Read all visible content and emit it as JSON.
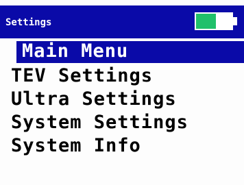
{
  "window": {
    "title": "Settings"
  },
  "status": {
    "battery_level": 0.55,
    "battery_color": "#20c06a"
  },
  "menu": {
    "items": [
      {
        "label": "Main Menu",
        "selected": true
      },
      {
        "label": "TEV Settings",
        "selected": false
      },
      {
        "label": "Ultra Settings",
        "selected": false
      },
      {
        "label": "System Settings",
        "selected": false
      },
      {
        "label": "System Info",
        "selected": false
      }
    ]
  },
  "colors": {
    "accent": "#0a0aa8",
    "background": "#fdfdfd",
    "text": "#000000",
    "selected_text": "#ffffff"
  }
}
